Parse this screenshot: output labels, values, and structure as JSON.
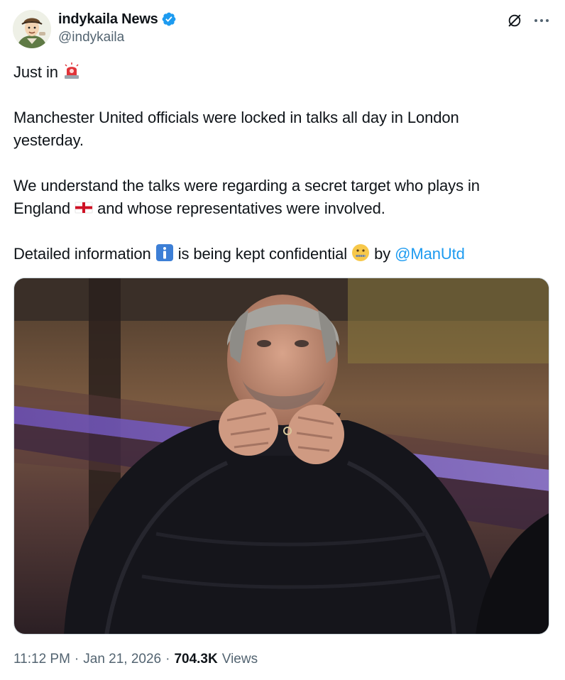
{
  "author": {
    "display_name": "indykaila News",
    "handle": "@indykaila",
    "verified": true,
    "verified_color": "#1d9bf0"
  },
  "header_icons": {
    "grok": "grok-icon",
    "more": "more-icon"
  },
  "tweet": {
    "line1": "Just in",
    "line1_emoji": "police-car-light-emoji",
    "para2": "Manchester United officials were locked in talks all day in London yesterday.",
    "para3_before_flag": "We understand the talks were regarding a secret target who plays in England",
    "para3_flag_emoji": "england-flag-emoji",
    "para3_after_flag": "and whose representatives were involved.",
    "para4_before_info": "Detailed information",
    "para4_info_emoji": "information-emoji",
    "para4_middle": "is being kept confidential",
    "para4_zipper_emoji": "zipper-mouth-face-emoji",
    "para4_by": "by",
    "mention": "@ManUtd",
    "mention_color": "#1d9bf0"
  },
  "media": {
    "description_icon": "photo"
  },
  "meta": {
    "time": "11:12 PM",
    "separator": "·",
    "date": "Jan 21, 2026",
    "views_count": "704.3K",
    "views_label": "Views"
  }
}
